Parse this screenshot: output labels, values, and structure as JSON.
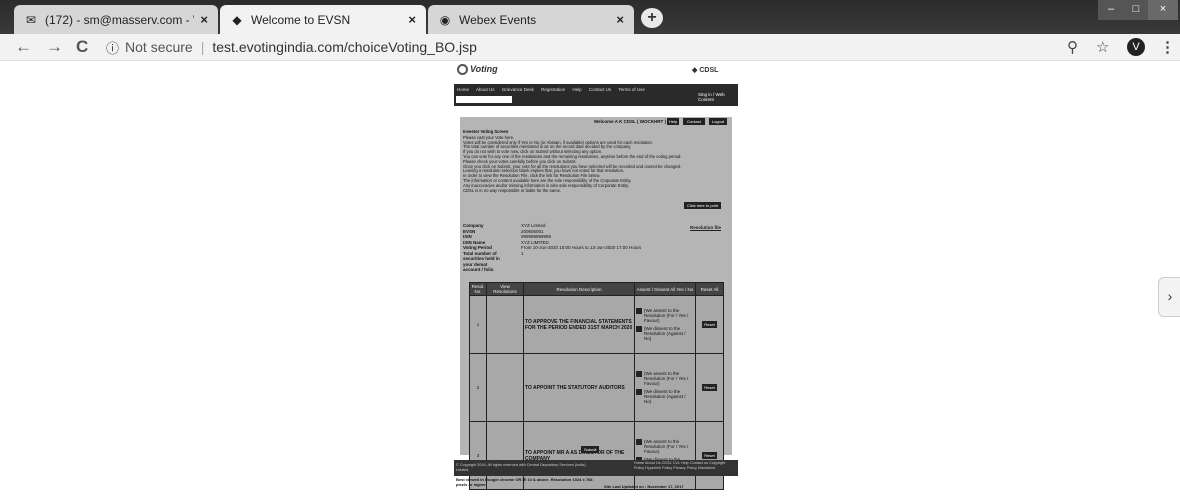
{
  "browser": {
    "tabs": [
      {
        "title": "(172) - sm@masserv.com - Webm",
        "icon": "mail-icon"
      },
      {
        "title": "Welcome to EVSN",
        "icon": "diamond-icon"
      },
      {
        "title": "Webex Events",
        "icon": "globe-icon"
      }
    ],
    "close_glyph": "×",
    "new_tab_glyph": "+",
    "window": {
      "minimize": "–",
      "maximize": "□",
      "close": "×"
    },
    "back": "←",
    "forward": "→",
    "reload": "C",
    "security_label": "Not secure",
    "url": "test.evotingindia.com/choiceVoting_BO.jsp",
    "zoom_glyph": "⚲",
    "star_glyph": "☆",
    "avatar_letter": "V",
    "menu_glyph": "⋮",
    "side_arrow": "›"
  },
  "site": {
    "logo_text": "Voting",
    "cdsl_text": "CDSL",
    "nav_items": [
      "Home",
      "About Us",
      "Grievance Desk",
      "Registration",
      "Help",
      "Contact Us",
      "Terms of Use"
    ],
    "signin_label": "Sing in / Web Content",
    "welcome": "Welcome A K CDSL ( WOCKHRT )",
    "header_buttons": [
      "Help",
      "Contact",
      "Logout"
    ],
    "instructions": [
      "Investor Voting Screen",
      "Please cast your Vote here.",
      "Votes will be considered only if Yes or No (or Abstain, if available) options are used for each resolution.",
      "The total number of securities mentioned is as on the record date decided by the company.",
      "If you do not wish to vote now, click on Submit without selecting any option.",
      "You can vote for any one of the resolutions and the remaining resolutions, anytime before the end of the voting period.",
      "Please check your votes carefully before you click on Submit.",
      "Once you click on Submit, your vote for all the resolutions you have selected will be recorded and cannot be changed.",
      "Leaving a resolution selection blank implies that, you have not voted for that resolution.",
      "In order to view the Resolution File, click the link for Resolution File below.",
      "The information or content available here are the sole responsibility of the Corporate Entity.",
      "Any inaccuracies and/or missing information is also sole responsibility of Corporate Entity.",
      "CDSL is in no way responsible or liable for the same."
    ],
    "pdf_button": "Click here to print",
    "info": [
      {
        "k": "Company",
        "v": "XYZ Limited"
      },
      {
        "k": "EVSN",
        "v": "200606001"
      },
      {
        "k": "ISIN",
        "v": "999999999999"
      },
      {
        "k": "ISIN Name",
        "v": "XYZ LIMITED"
      },
      {
        "k": "Voting Period",
        "v": "From 10-Jun-2020 15:00 Hours to 13-Jun-2020 17:00 Hours"
      },
      {
        "k": "Total number of securities held in your demat account / folio",
        "v": "1"
      }
    ],
    "resolution_file": "Resolution file",
    "table": {
      "headers": [
        "Resol. No.",
        "View Resolutions",
        "Resolution Description",
        "Assent / Dissent All Yes / No",
        "Reset All"
      ],
      "rows": [
        {
          "no": "1",
          "desc": "TO APPROVE THE FINANCIAL STATEMENTS FOR THE PERIOD ENDED 31ST MARCH 2020"
        },
        {
          "no": "2",
          "desc": "TO APPOINT THE STATUTORY AUDITORS"
        },
        {
          "no": "3",
          "desc": "TO APPOINT MR A AS DIRECTOR OF THE COMPANY"
        }
      ],
      "assent_label": "(We assent to the Resolution (For / Yes / Favour)",
      "dissent_label": "(We dissent to the Resolution (Against / No)",
      "reset_label": "Reset"
    },
    "submit": "Submit",
    "footer_left": "© Copyright 2016. All rights reserved with Central Depository Services (India) Limited.",
    "footer_right": "Home  About Us  CDSL  CVL  Help  Contact us  Copyright Policy  Hyperlink Policy  Privacy Policy  Disclaimer",
    "best_viewed": "Best viewed in Google chrome OR IE 10 & above. Resolution 1024 x 768 pixels or higher.",
    "last_updated": "Site Last Updated on : November 17, 2017"
  }
}
